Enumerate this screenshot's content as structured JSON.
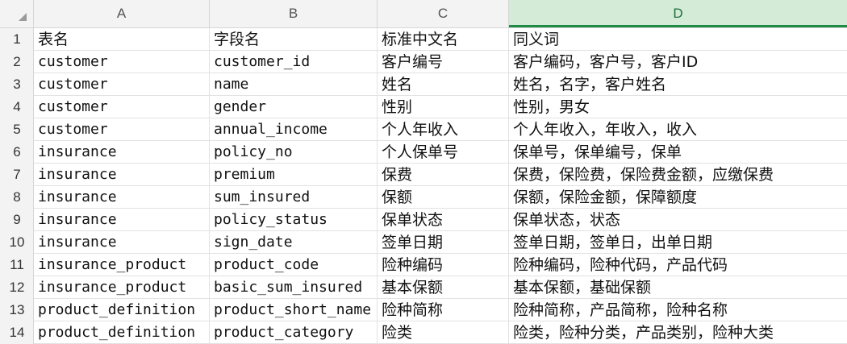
{
  "columns": [
    "A",
    "B",
    "C",
    "D"
  ],
  "active_column": "D",
  "rows": [
    {
      "num": "1",
      "a": "表名",
      "b": "字段名",
      "c": "标准中文名",
      "d": "同义词"
    },
    {
      "num": "2",
      "a": "customer",
      "b": "customer_id",
      "c": "客户编号",
      "d": "客户编码，客户号，客户ID"
    },
    {
      "num": "3",
      "a": "customer",
      "b": "name",
      "c": "姓名",
      "d": "姓名，名字，客户姓名"
    },
    {
      "num": "4",
      "a": "customer",
      "b": "gender",
      "c": "性别",
      "d": "性别，男女"
    },
    {
      "num": "5",
      "a": "customer",
      "b": "annual_income",
      "c": "个人年收入",
      "d": "个人年收入，年收入，收入"
    },
    {
      "num": "6",
      "a": "insurance",
      "b": "policy_no",
      "c": "个人保单号",
      "d": "保单号，保单编号，保单"
    },
    {
      "num": "7",
      "a": "insurance",
      "b": "premium",
      "c": "保费",
      "d": "保费，保险费，保险费金额，应缴保费"
    },
    {
      "num": "8",
      "a": "insurance",
      "b": "sum_insured",
      "c": "保额",
      "d": "保额，保险金额，保障额度"
    },
    {
      "num": "9",
      "a": "insurance",
      "b": "policy_status",
      "c": "保单状态",
      "d": "保单状态，状态"
    },
    {
      "num": "10",
      "a": "insurance",
      "b": "sign_date",
      "c": "签单日期",
      "d": "签单日期，签单日，出单日期"
    },
    {
      "num": "11",
      "a": "insurance_product",
      "b": "product_code",
      "c": "险种编码",
      "d": "险种编码，险种代码，产品代码"
    },
    {
      "num": "12",
      "a": "insurance_product",
      "b": "basic_sum_insured",
      "c": "基本保额",
      "d": "基本保额，基础保额"
    },
    {
      "num": "13",
      "a": "product_definition",
      "b": "product_short_name",
      "c": "险种简称",
      "d": "险种简称，产品简称，险种名称"
    },
    {
      "num": "14",
      "a": "product_definition",
      "b": "product_category",
      "c": "险类",
      "d": "险类，险种分类，产品类别，险种大类"
    }
  ]
}
